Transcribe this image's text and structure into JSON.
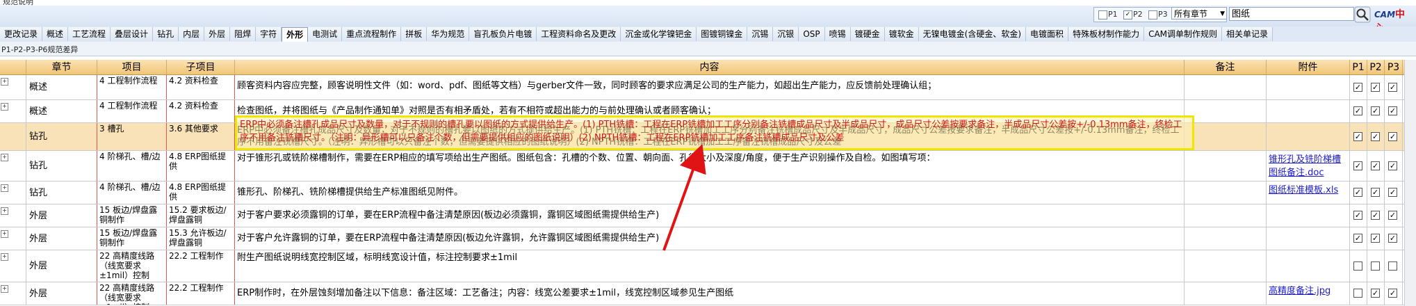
{
  "window": {
    "title": "规范说明"
  },
  "filters": {
    "options": [
      {
        "label": "P1",
        "checked": false
      },
      {
        "label": "P2",
        "checked": true
      },
      {
        "label": "P3",
        "checked": false
      }
    ],
    "chapter_select": "所有章节",
    "search_value": "图纸",
    "logo_text_a": "CAM",
    "logo_text_b": "中心"
  },
  "tabs": [
    {
      "label": "更改记录"
    },
    {
      "label": "概述"
    },
    {
      "label": "工艺流程"
    },
    {
      "label": "叠层设计"
    },
    {
      "label": "钻孔"
    },
    {
      "label": "内层"
    },
    {
      "label": "外层"
    },
    {
      "label": "阻焊"
    },
    {
      "label": "字符"
    },
    {
      "label": "外形",
      "active": true
    },
    {
      "label": "电测试"
    },
    {
      "label": "重点流程制作"
    },
    {
      "label": "拼板"
    },
    {
      "label": "华为规范"
    },
    {
      "label": "盲孔板负片电镀"
    },
    {
      "label": "工程资料命名及更改"
    },
    {
      "label": "沉金或化学镍钯金"
    },
    {
      "label": "图镀铜镍金"
    },
    {
      "label": "沉锡"
    },
    {
      "label": "沉银"
    },
    {
      "label": "OSP"
    },
    {
      "label": "喷锡"
    },
    {
      "label": "镀硬金"
    },
    {
      "label": "镀软金"
    },
    {
      "label": "无镍电镀金(含硬金、软金)"
    },
    {
      "label": "电镀面积"
    },
    {
      "label": "特殊板材制作能力"
    },
    {
      "label": "CAM调单制作规则"
    },
    {
      "label": "相关单记录"
    }
  ],
  "subtab": "P1-P2-P3-P6规范差异",
  "columns": {
    "chapter": "章节",
    "item": "项目",
    "subitem": "子项目",
    "content": "内容",
    "remark": "备注",
    "attach": "附件",
    "p1": "P1",
    "p2": "P2",
    "p3": "P3"
  },
  "rows": [
    {
      "chapter": "概述",
      "item": "4 工程制作流程",
      "subitem": "4.2 资料检查",
      "content": "顾客资料内容应完整，顾客说明性文件（如：word、pdf、图纸等文档）与gerber文件一致，同时顾客的要求应满足公司的生产能力，如超出生产能力，应反馈前处理确认组；",
      "remark": "",
      "attach": "",
      "p1": true,
      "p2": true,
      "p3": true
    },
    {
      "chapter": "概述",
      "item": "4 工程制作流程",
      "subitem": "4.2 资料检查",
      "content": "检查图纸，并将图纸与《产品制作通知单》对照是否有相矛盾处，若有不相符或超出能力的与前处理确认或者顾客确认；",
      "remark": "",
      "attach": "",
      "p1": true,
      "p2": true,
      "p3": true
    },
    {
      "chapter": "钻孔",
      "item": "3 槽孔",
      "subitem": "3.6 其他要求",
      "content": "ERP中必须备注槽孔成品尺寸及数量，对于不规则的槽孔要以图纸的方式提供给生产。(1) PTH铣槽：工程在ERP铣槽加工工序分别备注铣槽成品尺寸及半成品尺寸，成品尺寸公差按要求备注，半成品尺寸公差按+/-0.13mm备注，终检工序不用备注铣槽尺寸。（注明：异形槽可以只备注个数，但需要提供相应的图纸说明）(2) NPTH铣槽：工程在ERP铣槽加工工序备注铣槽成品尺寸及公差",
      "remark": "",
      "attach": "",
      "p1": true,
      "p2": true,
      "p3": true
    },
    {
      "chapter": "钻孔",
      "item": "4 阶梯孔、槽/边",
      "subitem": "4.8 ERP图纸提供",
      "content": "对于锥形孔或铣阶梯槽制作，需要在ERP相应的填写项给出生产图纸。图纸包含：孔槽的个数、位置、朝向面、孔径大小及深度/角度，便于生产识别操作及自检。如图填写项：",
      "remark": "",
      "attach": "锥形孔及铣阶梯槽图纸备注.doc",
      "p1": true,
      "p2": true,
      "p3": true
    },
    {
      "chapter": "钻孔",
      "item": "4 阶梯孔、槽/边",
      "subitem": "4.8 ERP图纸提供",
      "content": "锥形孔、阶梯孔、铣阶梯槽提供给生产标准图纸见附件。",
      "remark": "",
      "attach": "图纸标准模板.xls",
      "p1": true,
      "p2": true,
      "p3": true
    },
    {
      "chapter": "外层",
      "item": "15 板边/焊盘露铜制作",
      "subitem": "15.2 要求板边/焊盘露铜",
      "content": "对于客户要求必须露铜的订单，要在ERP流程中备注清楚原因(板边必须露铜，露铜区域图纸需提供给生产)",
      "remark": "",
      "attach": "",
      "p1": true,
      "p2": true,
      "p3": true
    },
    {
      "chapter": "外层",
      "item": "15 板边/焊盘露铜制作",
      "subitem": "15.3 允许板边/焊盘露铜",
      "content": "对于客户允许露铜的订单，要在ERP流程中备注清楚原因(板边允许露铜，允许露铜区域图纸需提供给生产)",
      "remark": "",
      "attach": "",
      "p1": true,
      "p2": true,
      "p3": true
    },
    {
      "chapter": "外层",
      "item": "22 高精度线路（线宽要求±1mil）控制",
      "subitem": "22.2 工程制作",
      "content": "附生产图纸说明线宽控制区域，标明线宽设计值，标注控制要求±1mil",
      "remark": "",
      "attach": "",
      "p1": false,
      "p2": false,
      "p3": false
    },
    {
      "chapter": "外层",
      "item": "22 高精度线路（线宽要求±1mil）控制",
      "subitem": "22.2 工程制作",
      "content": "ERP制作时，在外层蚀刻增加备注以下信息：备注区域：工艺备注；内容：线宽公差要求±1mil，线宽控制区域参见生产图纸",
      "remark": "",
      "attach": "高精度备注.jpg",
      "p1": false,
      "p2": true,
      "p3": true
    }
  ]
}
